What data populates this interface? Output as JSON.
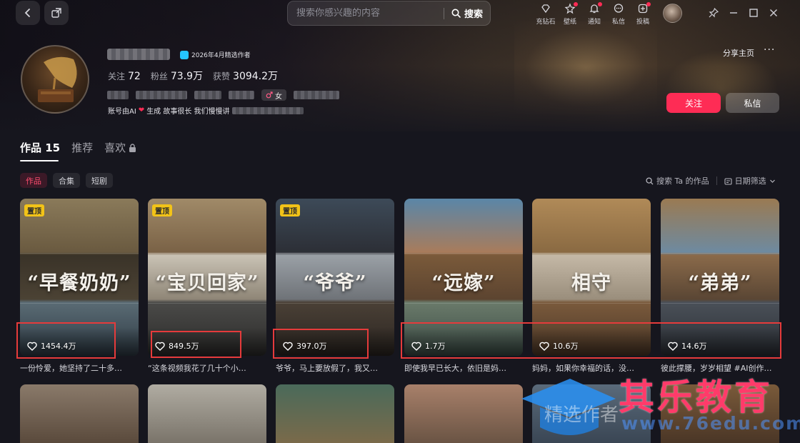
{
  "search": {
    "placeholder": "搜索你感兴趣的内容",
    "button_label": "搜索"
  },
  "toolbar": {
    "items": [
      {
        "label": "充钻石",
        "icon": "diamond-icon",
        "dot": false
      },
      {
        "label": "壁纸",
        "icon": "wallpaper-icon",
        "dot": true
      },
      {
        "label": "通知",
        "icon": "bell-icon",
        "dot": true
      },
      {
        "label": "私信",
        "icon": "chat-icon",
        "dot": false
      },
      {
        "label": "投稿",
        "icon": "upload-icon",
        "dot": true
      }
    ]
  },
  "profile": {
    "badge": "2026年4月精选作者",
    "stats": [
      {
        "label": "关注",
        "value": "72"
      },
      {
        "label": "粉丝",
        "value": "73.9万"
      },
      {
        "label": "获赞",
        "value": "3094.2万"
      }
    ],
    "gender": "女",
    "bio_prefix": "账号由AI",
    "bio_suffix": "生成 故事很长 我们慢慢讲",
    "share_label": "分享主页",
    "more_label": "···",
    "follow_label": "关注",
    "message_label": "私信"
  },
  "tabs": [
    {
      "label": "作品 15",
      "active": true
    },
    {
      "label": "推荐",
      "active": false
    },
    {
      "label": "喜欢",
      "active": false
    }
  ],
  "subtabs": [
    {
      "label": "作品",
      "active": true
    },
    {
      "label": "合集",
      "active": false
    },
    {
      "label": "短剧",
      "active": false
    }
  ],
  "filters": {
    "search_label": "搜索 Ta 的作品",
    "date_label": "日期筛选"
  },
  "videos": [
    {
      "pin": "置顶",
      "title_art": "“早餐奶奶”",
      "likes": "1454.4万",
      "caption": "一份怜爱，她坚持了二十多…"
    },
    {
      "pin": "置顶",
      "title_art": "“宝贝回家”",
      "likes": "849.5万",
      "caption": "“这条视频我花了几十个小…"
    },
    {
      "pin": "置顶",
      "title_art": "“爷爷”",
      "likes": "397.0万",
      "caption": "爷爷，马上要放假了，我又…"
    },
    {
      "pin": "",
      "title_art": "“远嫁”",
      "likes": "1.7万",
      "caption": "即使我早已长大，依旧是妈…"
    },
    {
      "pin": "",
      "title_art": "相守",
      "likes": "10.6万",
      "caption": "妈妈，如果你幸福的话，没…"
    },
    {
      "pin": "",
      "title_art": "“弟弟”",
      "likes": "14.6万",
      "caption": "彼此撑腰，岁岁相望 #AI创作…"
    }
  ],
  "watermark": {
    "brand": "其乐教育",
    "url": "www.76edu.com",
    "ghost": "精选作者"
  },
  "colors": {
    "accent": "#fe2c55",
    "highlight_box": "#e63b3b",
    "pin_badge": "#f2c318"
  }
}
